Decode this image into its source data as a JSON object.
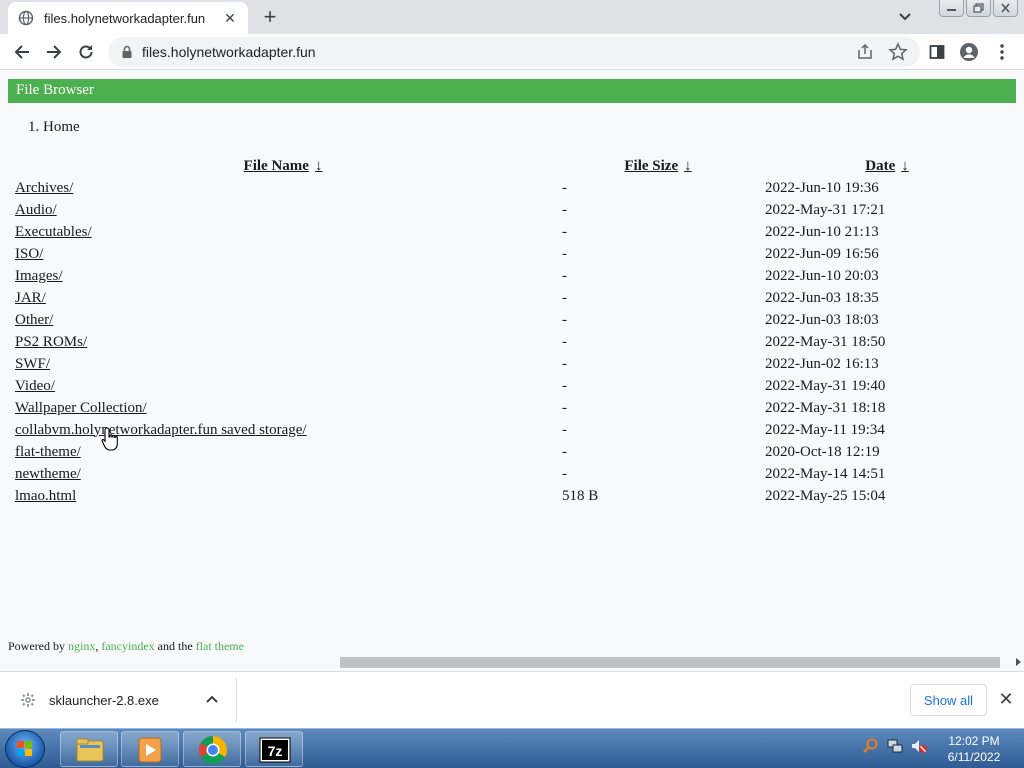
{
  "browser": {
    "tab_title": "files.holynetworkadapter.fun",
    "url": "files.holynetworkadapter.fun",
    "window_controls": [
      "minimize",
      "restore",
      "close"
    ]
  },
  "page": {
    "banner_title": "File Browser",
    "breadcrumb_number": "1.",
    "breadcrumb_label": "Home",
    "columns": {
      "name": "File Name",
      "size": "File Size",
      "date": "Date",
      "sort_arrow": "↓"
    },
    "rows": [
      {
        "name": "Archives/",
        "size": "-",
        "date": "2022-Jun-10 19:36"
      },
      {
        "name": "Audio/",
        "size": "-",
        "date": "2022-May-31 17:21"
      },
      {
        "name": "Executables/",
        "size": "-",
        "date": "2022-Jun-10 21:13"
      },
      {
        "name": "ISO/",
        "size": "-",
        "date": "2022-Jun-09 16:56"
      },
      {
        "name": "Images/",
        "size": "-",
        "date": "2022-Jun-10 20:03"
      },
      {
        "name": "JAR/",
        "size": "-",
        "date": "2022-Jun-03 18:35"
      },
      {
        "name": "Other/",
        "size": "-",
        "date": "2022-Jun-03 18:03"
      },
      {
        "name": "PS2 ROMs/",
        "size": "-",
        "date": "2022-May-31 18:50"
      },
      {
        "name": "SWF/",
        "size": "-",
        "date": "2022-Jun-02 16:13"
      },
      {
        "name": "Video/",
        "size": "-",
        "date": "2022-May-31 19:40"
      },
      {
        "name": "Wallpaper Collection/",
        "size": "-",
        "date": "2022-May-31 18:18"
      },
      {
        "name": "collabvm.holynetworkadapter.fun saved storage/",
        "size": "-",
        "date": "2022-May-11 19:34"
      },
      {
        "name": "flat-theme/",
        "size": "-",
        "date": "2020-Oct-18 12:19"
      },
      {
        "name": "newtheme/",
        "size": "-",
        "date": "2022-May-14 14:51"
      },
      {
        "name": "lmao.html",
        "size": "518 B",
        "date": "2022-May-25 15:04"
      }
    ],
    "footer": {
      "prefix": "Powered by",
      "link1": "nginx",
      "sep": ",",
      "link2": "fancyindex",
      "middle": "and the",
      "link3": "flat theme"
    }
  },
  "downloads": {
    "filename": "sklauncher-2.8.exe",
    "show_all": "Show all"
  },
  "taskbar": {
    "apps": [
      "file-explorer",
      "media-player",
      "chrome",
      "7-zip"
    ],
    "clock_time": "12:02 PM",
    "clock_date": "6/11/2022"
  },
  "colors": {
    "banner": "#4caf50",
    "link_accent": "#4caf50",
    "show_all_text": "#1a73e8"
  }
}
